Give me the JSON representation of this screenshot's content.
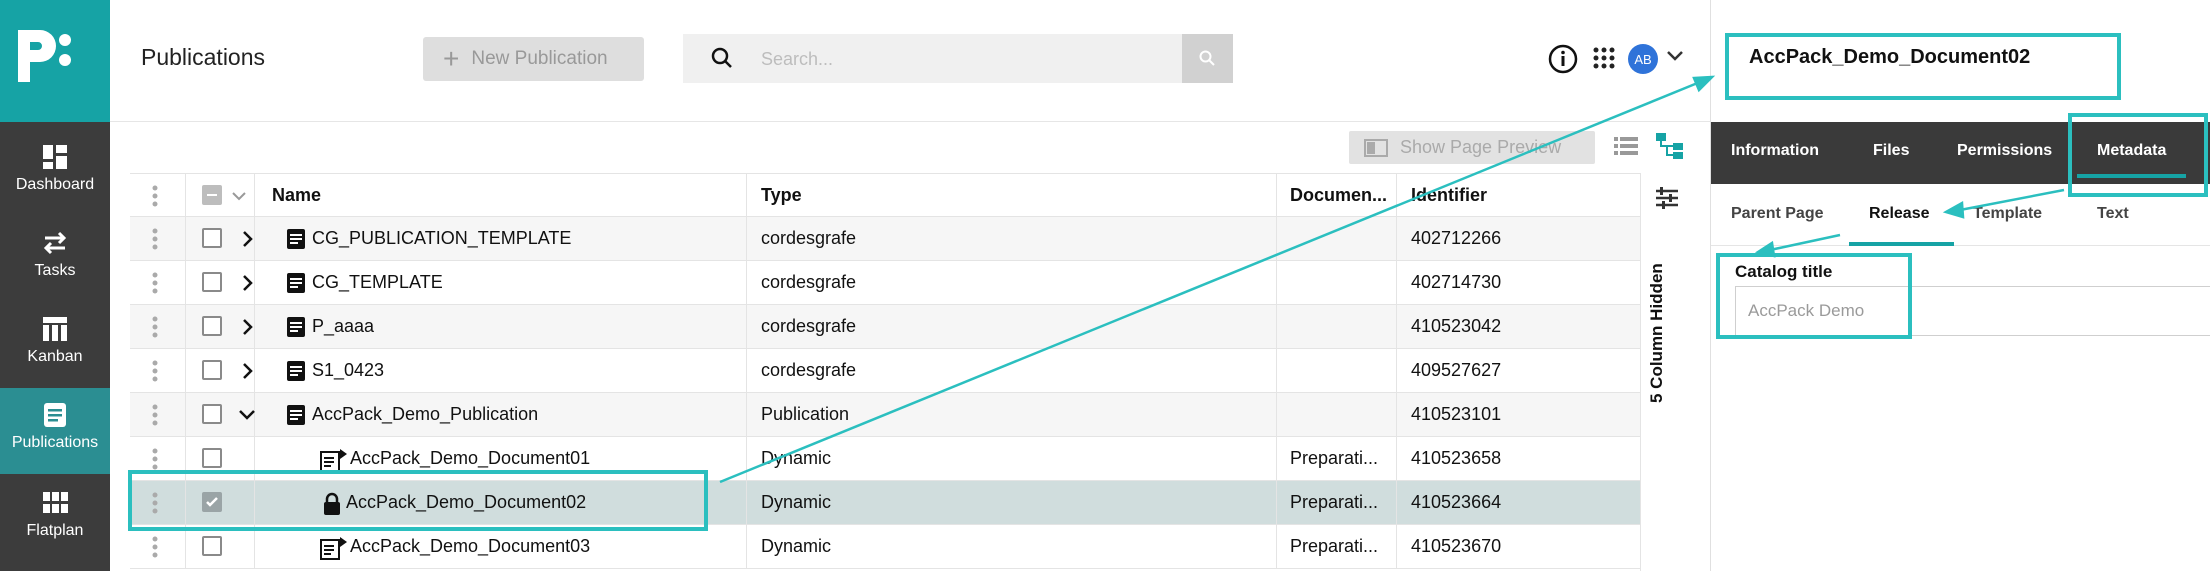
{
  "nav": {
    "items": [
      {
        "label": "Dashboard",
        "icon": "dashboard-icon"
      },
      {
        "label": "Tasks",
        "icon": "tasks-icon"
      },
      {
        "label": "Kanban",
        "icon": "kanban-icon"
      },
      {
        "label": "Publications",
        "icon": "publications-icon",
        "active": true
      },
      {
        "label": "Flatplan",
        "icon": "flatplan-icon"
      }
    ]
  },
  "header": {
    "title": "Publications",
    "new_button": "New Publication",
    "search_placeholder": "Search...",
    "avatar": "AB"
  },
  "toolbar": {
    "preview_button": "Show Page Preview"
  },
  "grid": {
    "columns": [
      "Name",
      "Type",
      "Documen...",
      "Identifier"
    ],
    "hidden_columns": "5 Column Hidden",
    "rows": [
      {
        "name": "CG_PUBLICATION_TEMPLATE",
        "type": "cordesgrafe",
        "document": "",
        "identifier": "402712266",
        "expand": "right",
        "icon": "document-icon",
        "checked": false
      },
      {
        "name": "CG_TEMPLATE",
        "type": "cordesgrafe",
        "document": "",
        "identifier": "402714730",
        "expand": "right",
        "icon": "document-icon",
        "checked": false
      },
      {
        "name": "P_aaaa",
        "type": "cordesgrafe",
        "document": "",
        "identifier": "410523042",
        "expand": "right",
        "icon": "document-icon",
        "checked": false
      },
      {
        "name": "S1_0423",
        "type": "cordesgrafe",
        "document": "",
        "identifier": "409527627",
        "expand": "right",
        "icon": "document-icon",
        "checked": false
      },
      {
        "name": "AccPack_Demo_Publication",
        "type": "Publication",
        "document": "",
        "identifier": "410523101",
        "expand": "down",
        "icon": "document-icon",
        "checked": false
      },
      {
        "name": "AccPack_Demo_Document01",
        "type": "Dynamic",
        "document": "Preparati...",
        "identifier": "410523658",
        "expand": "none",
        "icon": "dynamic-doc-icon",
        "checked": false
      },
      {
        "name": "AccPack_Demo_Document02",
        "type": "Dynamic",
        "document": "Preparati...",
        "identifier": "410523664",
        "expand": "none",
        "icon": "lock-icon",
        "checked": true
      },
      {
        "name": "AccPack_Demo_Document03",
        "type": "Dynamic",
        "document": "Preparati...",
        "identifier": "410523670",
        "expand": "none",
        "icon": "dynamic-doc-icon",
        "checked": false
      }
    ]
  },
  "panel": {
    "title": "AccPack_Demo_Document02",
    "tabs": [
      "Information",
      "Files",
      "Permissions",
      "Metadata"
    ],
    "active_tab": "Metadata",
    "subtabs": [
      "Parent Page",
      "Release",
      "Template",
      "Text"
    ],
    "active_subtab": "Release",
    "catalog_label": "Catalog title",
    "catalog_value": "AccPack Demo"
  },
  "colors": {
    "brand_teal": "#16a3a5",
    "nav_bg": "#3c3c3c",
    "annotation": "#2bbfbf",
    "selected_row": "#d0dddd",
    "avatar": "#2f73d9"
  }
}
